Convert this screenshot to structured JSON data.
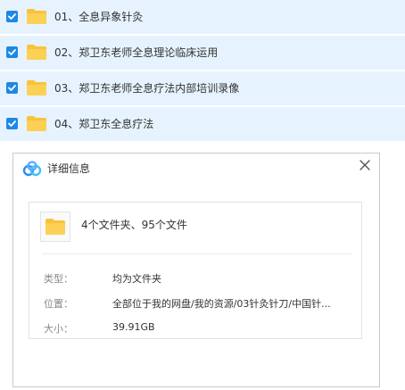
{
  "file_list": [
    {
      "name": "01、全息异象针灸",
      "checked": true
    },
    {
      "name": "02、郑卫东老师全息理论临床运用",
      "checked": true
    },
    {
      "name": "03、郑卫东老师全息疗法内部培训录像",
      "checked": true
    },
    {
      "name": "04、郑卫东全息疗法",
      "checked": true
    }
  ],
  "dialog": {
    "title": "详细信息",
    "summary": "4个文件夹、95个文件",
    "properties": {
      "type_label": "类型：",
      "type_value": "均为文件夹",
      "location_label": "位置：",
      "location_value": "全部位于我的网盘/我的资源/03针灸针刀/中国针...",
      "size_label": "大小：",
      "size_value": "39.91GB"
    }
  },
  "icons": {
    "checkbox": "checkbox-checked-icon",
    "folder": "folder-icon",
    "logo": "baidu-netdisk-logo-icon",
    "close": "close-icon"
  },
  "colors": {
    "row_bg": "#e6f3ff",
    "checkbox": "#1e88e5",
    "folder": "#f8c33a"
  }
}
